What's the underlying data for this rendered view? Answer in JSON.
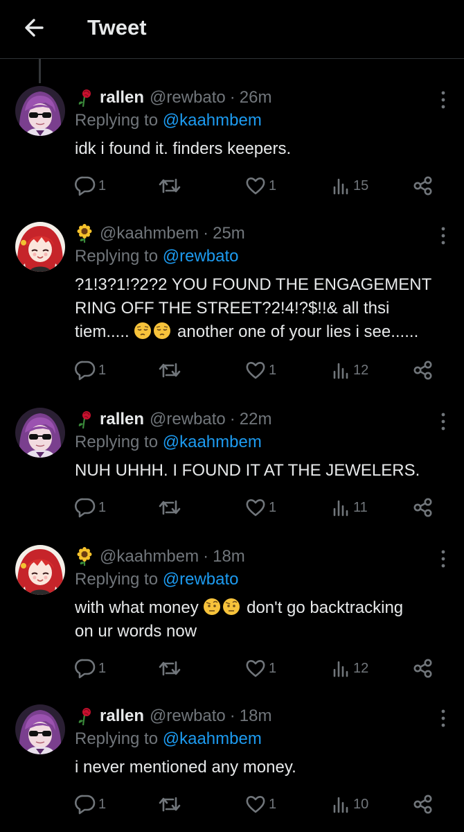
{
  "header": {
    "title": "Tweet"
  },
  "tweets": [
    {
      "name": "rallen",
      "handle": "@rewbato",
      "sep": "·",
      "time": "26m",
      "replying_prefix": "Replying to",
      "replying_to": "@kaahmbem",
      "text": "idk i found it. finders keepers.",
      "replies": "1",
      "likes": "1",
      "views": "15",
      "avatar": "purple-hair"
    },
    {
      "name": "",
      "handle": "@kaahmbem",
      "sep": "·",
      "time": "25m",
      "replying_prefix": "Replying to",
      "replying_to": "@rewbato",
      "text_line1": "?1!3?1!?2?2 YOU FOUND THE ENGAGEMENT",
      "text_line2": "RING OFF THE STREET?2!4!?$!!& all thsi",
      "text_line3a": "tiem.....",
      "text_line3b": "another one of your lies i see......",
      "replies": "1",
      "likes": "1",
      "views": "12",
      "avatar": "red-hair"
    },
    {
      "name": "rallen",
      "handle": "@rewbato",
      "sep": "·",
      "time": "22m",
      "replying_prefix": "Replying to",
      "replying_to": "@kaahmbem",
      "text": "NUH UHHH. I FOUND IT AT THE JEWELERS.",
      "replies": "1",
      "likes": "1",
      "views": "11",
      "avatar": "purple-hair"
    },
    {
      "name": "",
      "handle": "@kaahmbem",
      "sep": "·",
      "time": "18m",
      "replying_prefix": "Replying to",
      "replying_to": "@rewbato",
      "text_line1a": "with what money",
      "text_line1b": "don't go backtracking",
      "text_line2": "on ur words now",
      "replies": "1",
      "likes": "1",
      "views": "12",
      "avatar": "red-hair"
    },
    {
      "name": "rallen",
      "handle": "@rewbato",
      "sep": "·",
      "time": "18m",
      "replying_prefix": "Replying to",
      "replying_to": "@kaahmbem",
      "text": "i never mentioned any money.",
      "replies": "1",
      "likes": "1",
      "views": "10",
      "avatar": "purple-hair"
    }
  ],
  "colors": {
    "background": "#000000",
    "text": "#e7e9ea",
    "muted": "#71767b",
    "accent": "#1d9bf0"
  },
  "icons": [
    "back-arrow-icon",
    "rose-icon",
    "sunflower-icon",
    "more-icon",
    "reply-icon",
    "retweet-icon",
    "like-icon",
    "views-icon",
    "share-icon",
    "pensive-emoji",
    "raised-eyebrow-emoji"
  ]
}
